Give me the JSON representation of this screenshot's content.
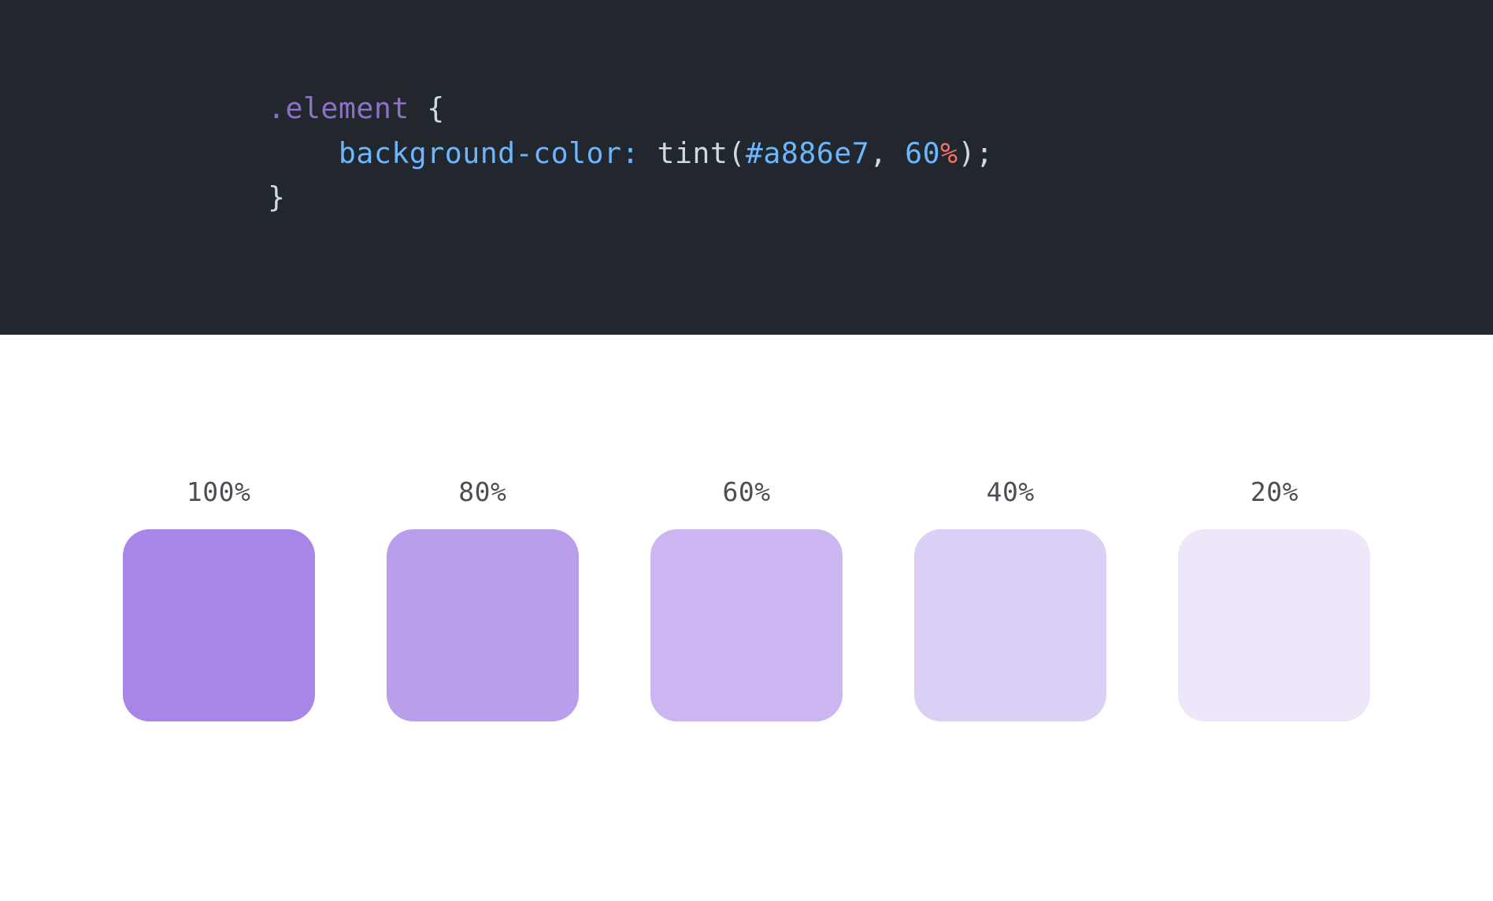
{
  "code": {
    "selector": ".element",
    "open_brace": "{",
    "close_brace": "}",
    "property": "background-color",
    "colon": ":",
    "fn": "tint",
    "lparen": "(",
    "hex": "#a886e7",
    "comma": ",",
    "num": "60",
    "unit": "%",
    "rparen": ")",
    "semi": ";"
  },
  "swatches": [
    {
      "label": "100%",
      "color": "#a886e7"
    },
    {
      "label": "80%",
      "color": "#b99eec"
    },
    {
      "label": "60%",
      "color": "#cbb6f1"
    },
    {
      "label": "40%",
      "color": "#dccff5"
    },
    {
      "label": "20%",
      "color": "#eee7fa"
    }
  ]
}
